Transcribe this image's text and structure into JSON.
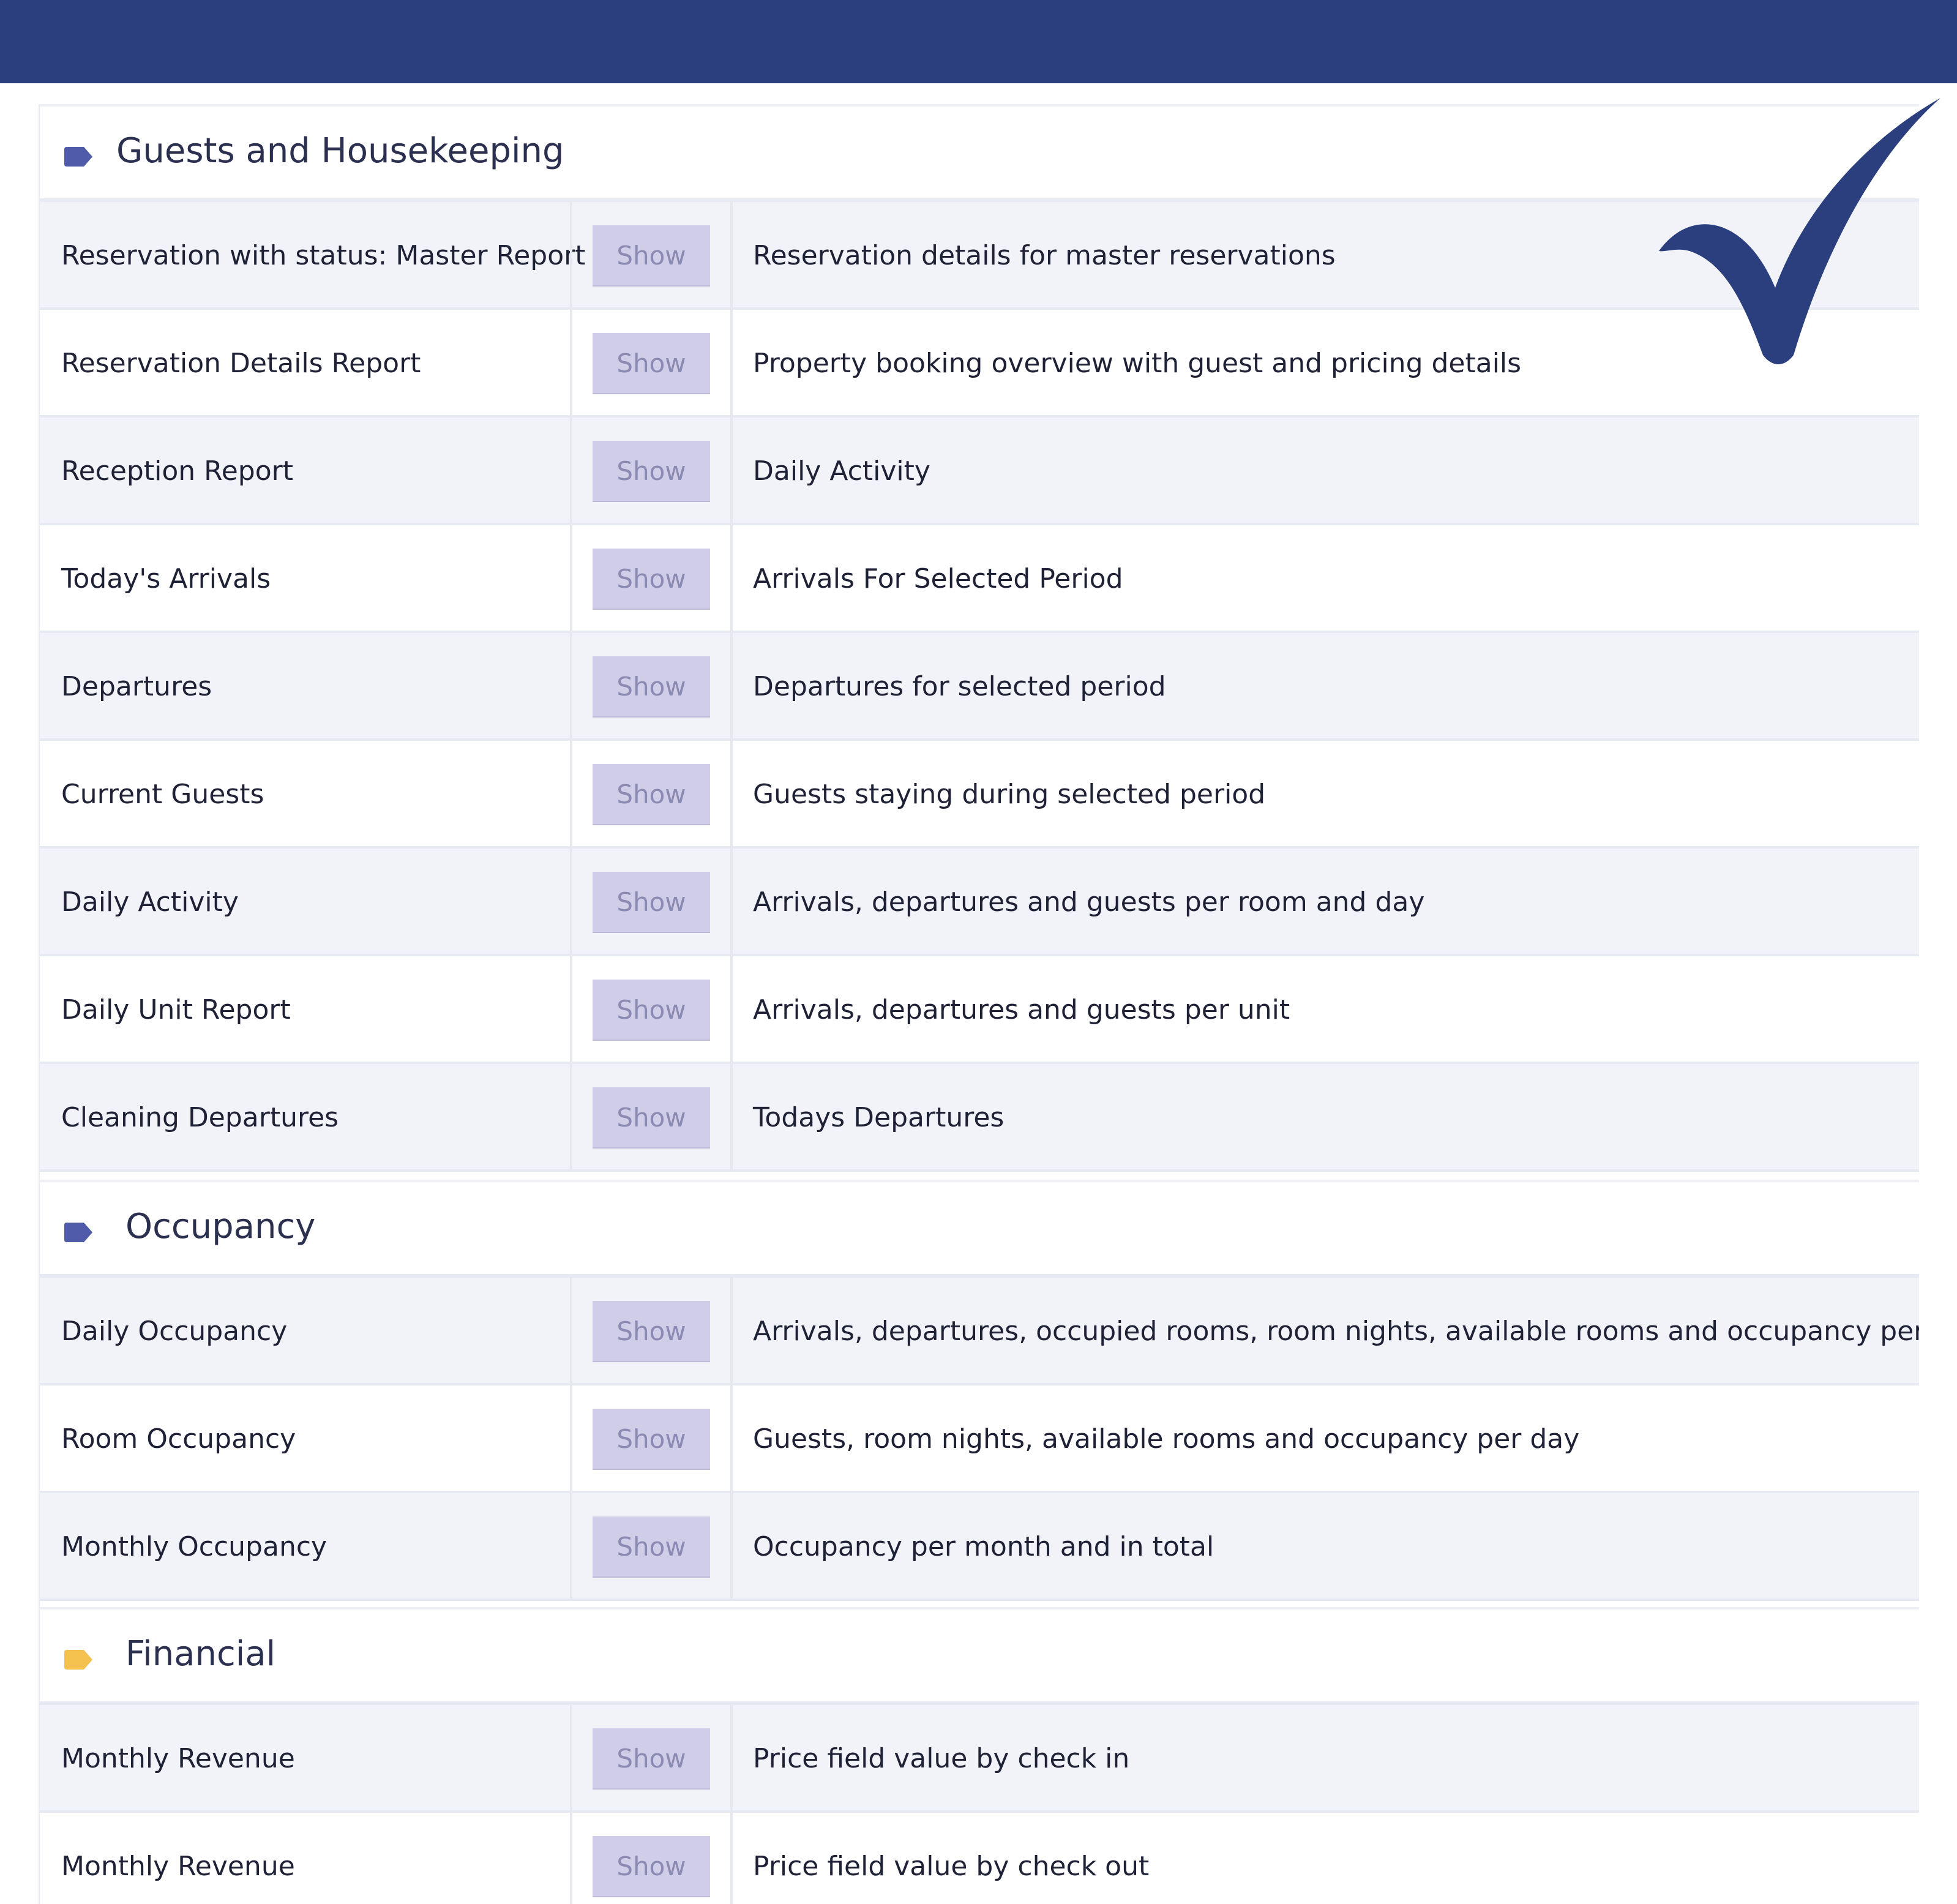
{
  "colors": {
    "topbar": "#2b3e7e",
    "tag_purple": "#4f5ba8",
    "tag_yellow": "#f4c14f",
    "checkmark": "#2b3e7e",
    "button_bg": "#cfcde7",
    "button_text": "#8a8ab2"
  },
  "icons": {
    "section_tag": "tag-icon",
    "check": "checkmark-icon"
  },
  "sections": [
    {
      "title": "Guests and Housekeeping",
      "tag_color": "#4f5ba8",
      "rows": [
        {
          "name": "Reservation with status: Master Report",
          "button": "Show",
          "description": "Reservation details for master reservations"
        },
        {
          "name": "Reservation Details Report",
          "button": "Show",
          "description": "Property booking overview with guest and pricing details"
        },
        {
          "name": "Reception Report",
          "button": "Show",
          "description": "Daily Activity"
        },
        {
          "name": "Today's Arrivals",
          "button": "Show",
          "description": "Arrivals For Selected Period"
        },
        {
          "name": "Departures",
          "button": "Show",
          "description": "Departures for selected period"
        },
        {
          "name": "Current Guests",
          "button": "Show",
          "description": "Guests staying during selected period"
        },
        {
          "name": "Daily Activity",
          "button": "Show",
          "description": "Arrivals, departures and guests per room and day"
        },
        {
          "name": "Daily Unit Report",
          "button": "Show",
          "description": "Arrivals, departures and guests per unit"
        },
        {
          "name": "Cleaning Departures",
          "button": "Show",
          "description": "Todays Departures"
        }
      ]
    },
    {
      "title": "Occupancy",
      "tag_color": "#4f5ba8",
      "rows": [
        {
          "name": "Daily Occupancy",
          "button": "Show",
          "description": "Arrivals, departures, occupied rooms, room nights, available rooms and occupancy per day"
        },
        {
          "name": "Room Occupancy",
          "button": "Show",
          "description": "Guests, room nights, available rooms and occupancy per day"
        },
        {
          "name": "Monthly Occupancy",
          "button": "Show",
          "description": "Occupancy per month and in total"
        }
      ]
    },
    {
      "title": "Financial",
      "tag_color": "#f4c14f",
      "rows": [
        {
          "name": "Monthly Revenue",
          "button": "Show",
          "description": "Price field value by check in"
        },
        {
          "name": "Monthly Revenue",
          "button": "Show",
          "description": "Price field value by check out"
        }
      ]
    }
  ]
}
